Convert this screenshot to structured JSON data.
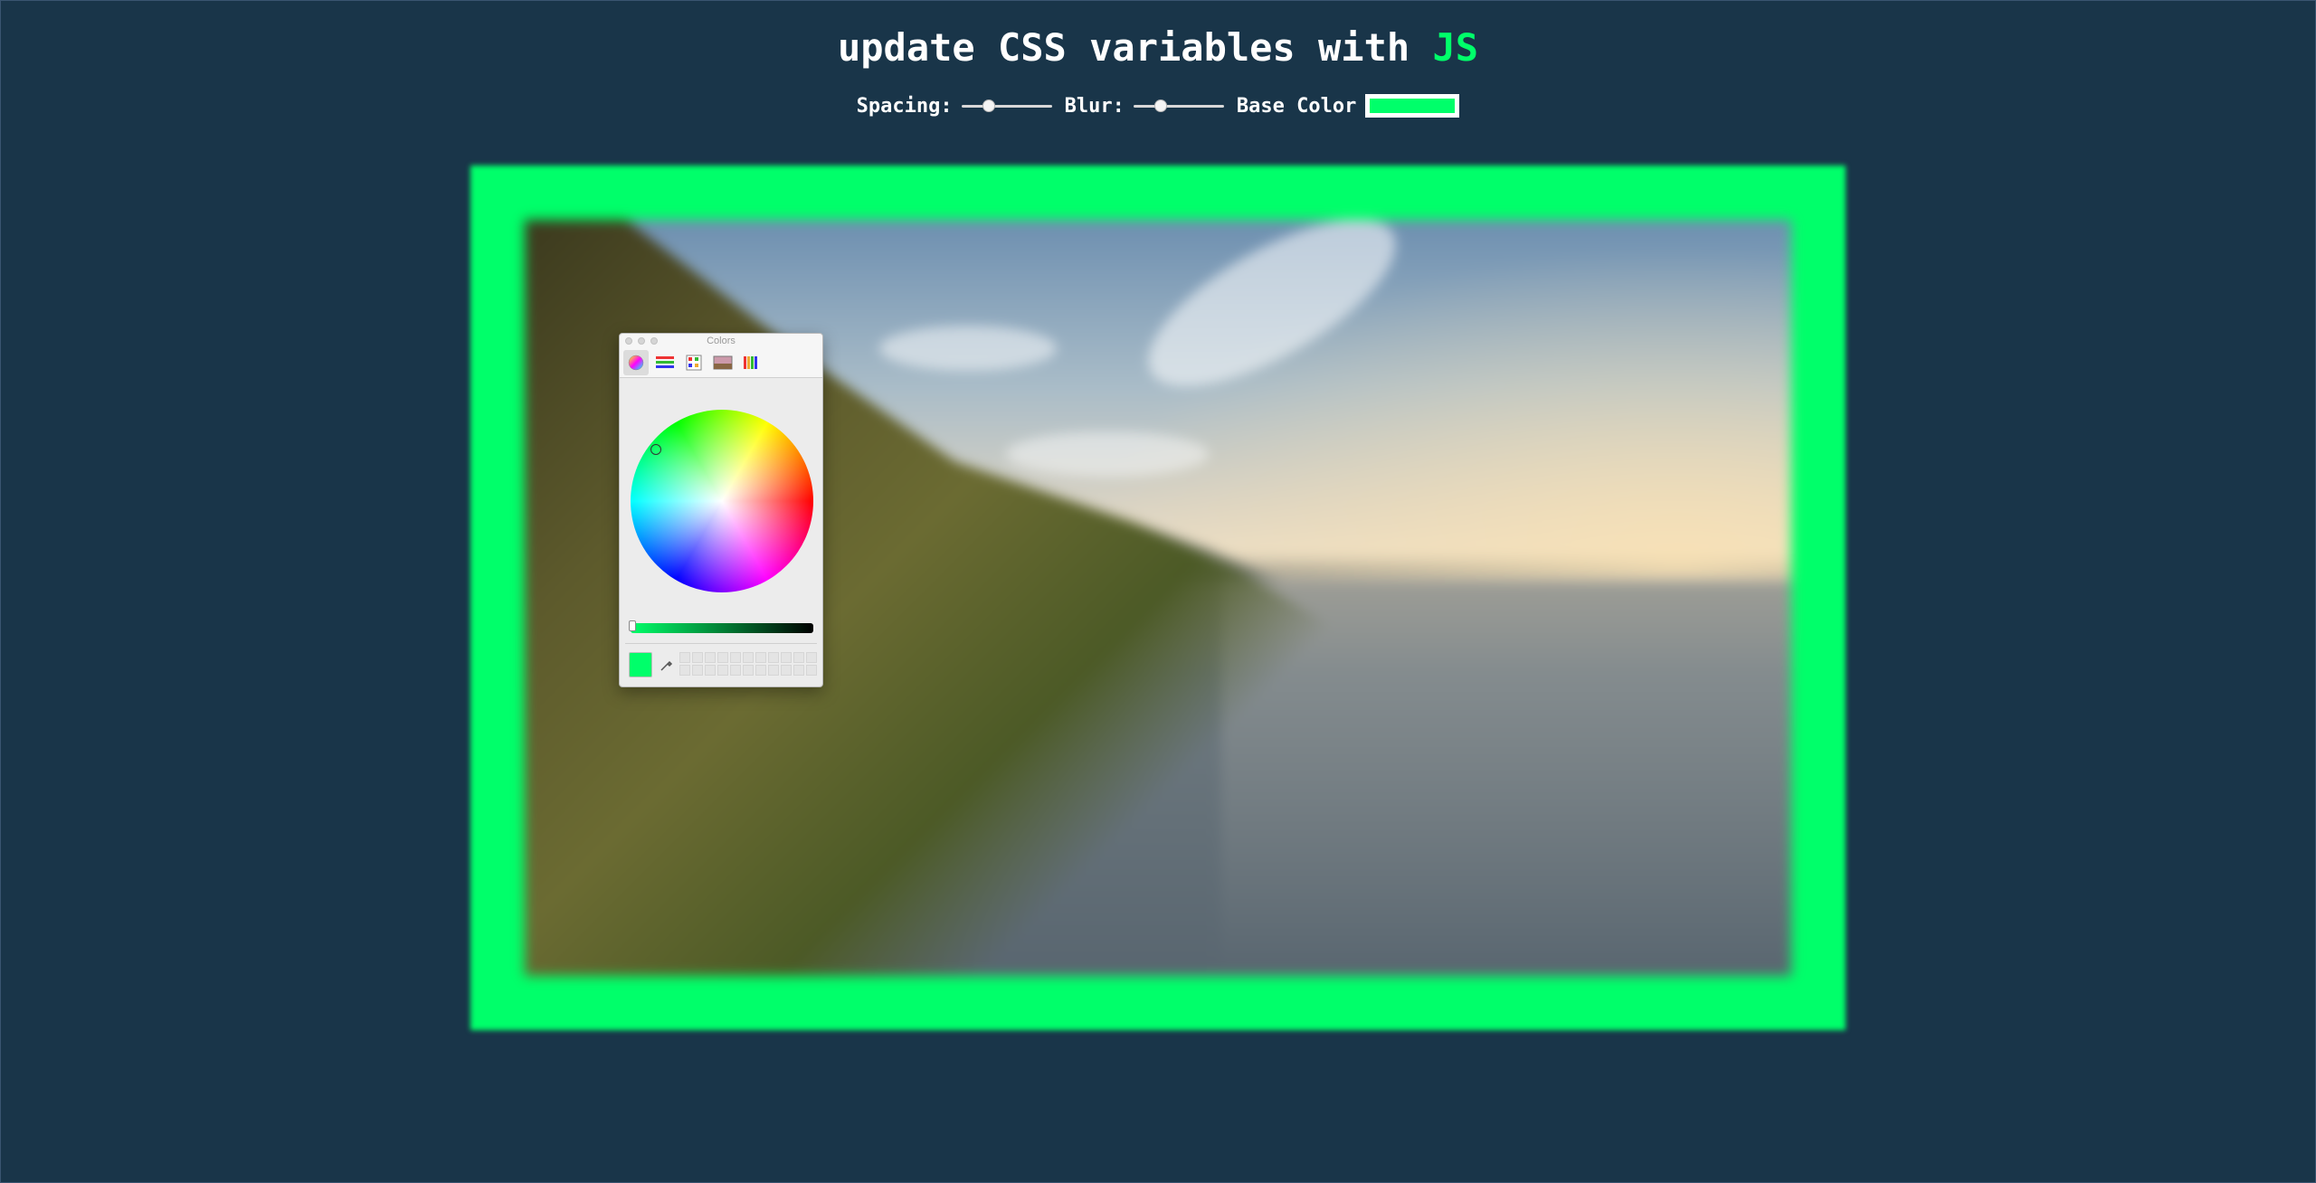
{
  "header": {
    "title_prefix": "update CSS variables with",
    "title_accent": "JS"
  },
  "controls": {
    "spacing_label": "Spacing:",
    "spacing_value": 0.3,
    "blur_label": "Blur:",
    "blur_value": 0.3,
    "base_color_label": "Base Color",
    "base_color_value": "#00ff6a"
  },
  "colors_panel": {
    "title": "Colors",
    "tools": [
      "color-wheel-icon",
      "color-sliders-icon",
      "color-palettes-icon",
      "image-palettes-icon",
      "pencils-icon"
    ]
  },
  "colors": {
    "background": "#193549",
    "accent": "#00ff6a"
  }
}
